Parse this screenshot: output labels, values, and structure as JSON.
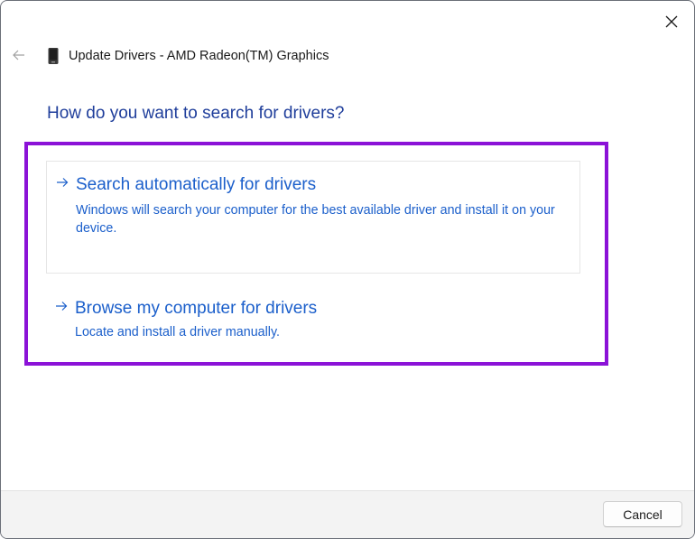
{
  "window": {
    "close_icon": "close-icon",
    "back_icon": "back-arrow-icon"
  },
  "header": {
    "device_icon": "device-icon",
    "title": "Update Drivers - AMD Radeon(TM) Graphics"
  },
  "main": {
    "question": "How do you want to search for drivers?",
    "options": [
      {
        "icon": "arrow-right-icon",
        "title": "Search automatically for drivers",
        "description": "Windows will search your computer for the best available driver and install it on your device."
      },
      {
        "icon": "arrow-right-icon",
        "title": "Browse my computer for drivers",
        "description": "Locate and install a driver manually."
      }
    ]
  },
  "footer": {
    "cancel_label": "Cancel"
  },
  "colors": {
    "accent_text": "#1b5fcb",
    "heading": "#1f3e9b",
    "highlight_border": "#8b12d7",
    "footer_bg": "#f3f3f3"
  }
}
